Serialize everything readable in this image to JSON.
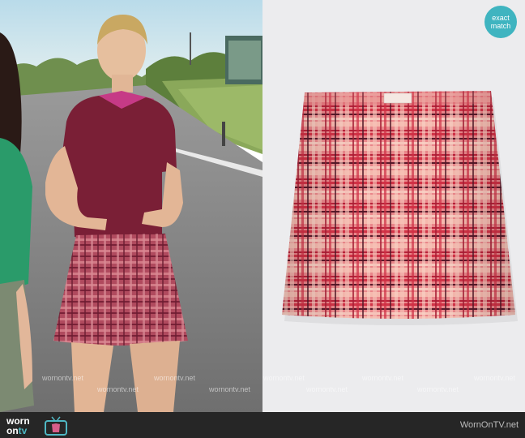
{
  "badge": {
    "line1": "exact",
    "line2": "match"
  },
  "logo": {
    "part1": "worn",
    "part2": "on",
    "part3": "tv"
  },
  "footer": {
    "site": "WornOnTV.net"
  },
  "watermark": {
    "text": "wornontv.net"
  },
  "colors": {
    "badge": "#3fb4c0",
    "footer_bg": "#262626",
    "logo_accent": "#4fb8c4",
    "skirt_base": "#e9868a"
  }
}
